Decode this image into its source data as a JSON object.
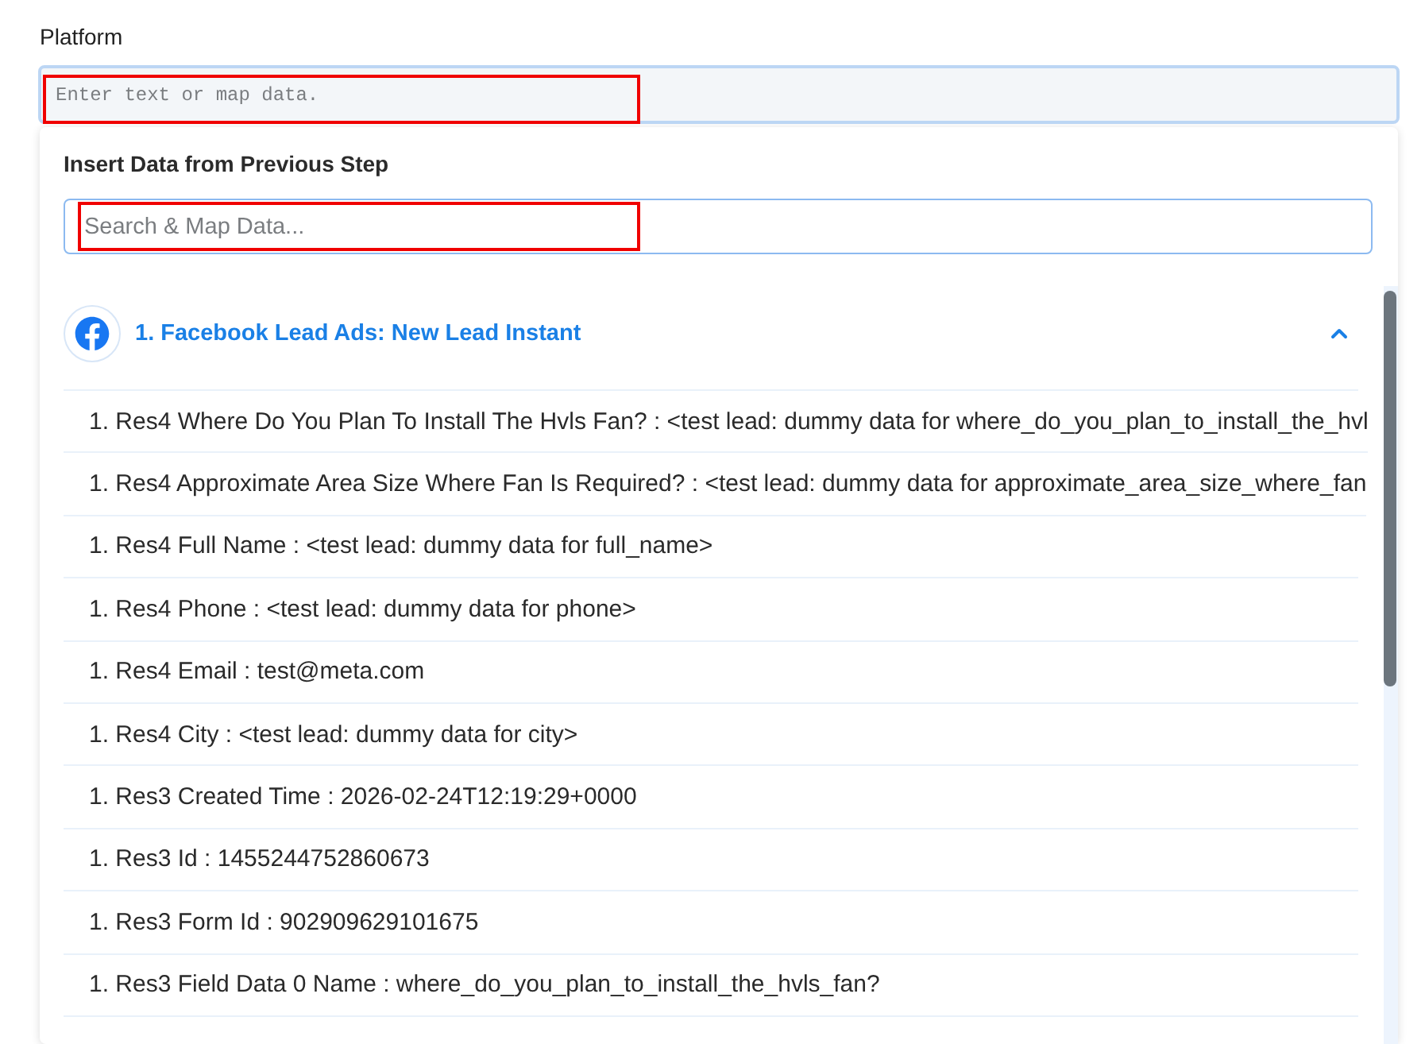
{
  "field": {
    "label": "Platform",
    "placeholder": "Enter text or map data.",
    "highlighted": true
  },
  "panel": {
    "title": "Insert Data from Previous Step",
    "search": {
      "placeholder": "Search & Map Data...",
      "highlighted": true
    },
    "steps": [
      {
        "title": "1. Facebook Lead Ads: New Lead Instant",
        "expanded": true,
        "items": [
          "1. Res4 Where Do You Plan To Install The Hvls Fan? : <test lead: dummy data for where_do_you_plan_to_install_the_hvl",
          "1. Res4 Approximate Area Size Where Fan Is Required? : <test lead: dummy data for approximate_area_size_where_fan",
          "1. Res4 Full Name : <test lead: dummy data for full_name>",
          "1. Res4 Phone : <test lead: dummy data for phone>",
          "1. Res4 Email : test@meta.com",
          "1. Res4 City : <test lead: dummy data for city>",
          "1. Res3 Created Time : 2026-02-24T12:19:29+0000",
          "1. Res3 Id : 1455244752860673",
          "1. Res3 Form Id : 902909629101675",
          "1. Res3 Field Data 0 Name : where_do_you_plan_to_install_the_hvls_fan?"
        ]
      }
    ]
  }
}
